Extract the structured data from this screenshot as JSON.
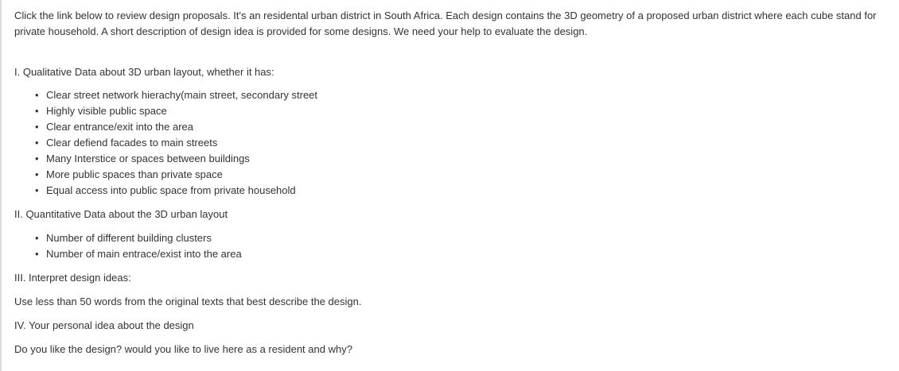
{
  "intro": {
    "line1": "Click the link below to review design proposals. It's an residental urban district in South Africa. Each design contains the 3D geometry of a proposed urban district where each cube stand for",
    "line2": "private household. A short description of design idea is provided for some designs. We need your help to evaluate the design."
  },
  "sections": [
    {
      "heading": "I. Qualitative Data about 3D urban layout, whether it has:",
      "items": [
        "Clear street network hierachy(main street, secondary street",
        "Highly visible public space",
        "Clear entrance/exit into the area",
        "Clear defiend facades to main streets",
        "Many Interstice or spaces between buildings",
        "More public spaces than private space",
        "Equal access into public space from private household"
      ]
    },
    {
      "heading": "II. Quantitative Data about the 3D urban layout",
      "items": [
        "Number of different building clusters",
        "Number of main entrace/exist into the area"
      ]
    },
    {
      "heading": "III. Interpret design ideas:",
      "text": "Use less than 50 words from the original texts that best describe the design."
    },
    {
      "heading": "IV. Your personal idea about the design",
      "text": "Do you like the design? would you like to live here as a resident and why?"
    }
  ]
}
